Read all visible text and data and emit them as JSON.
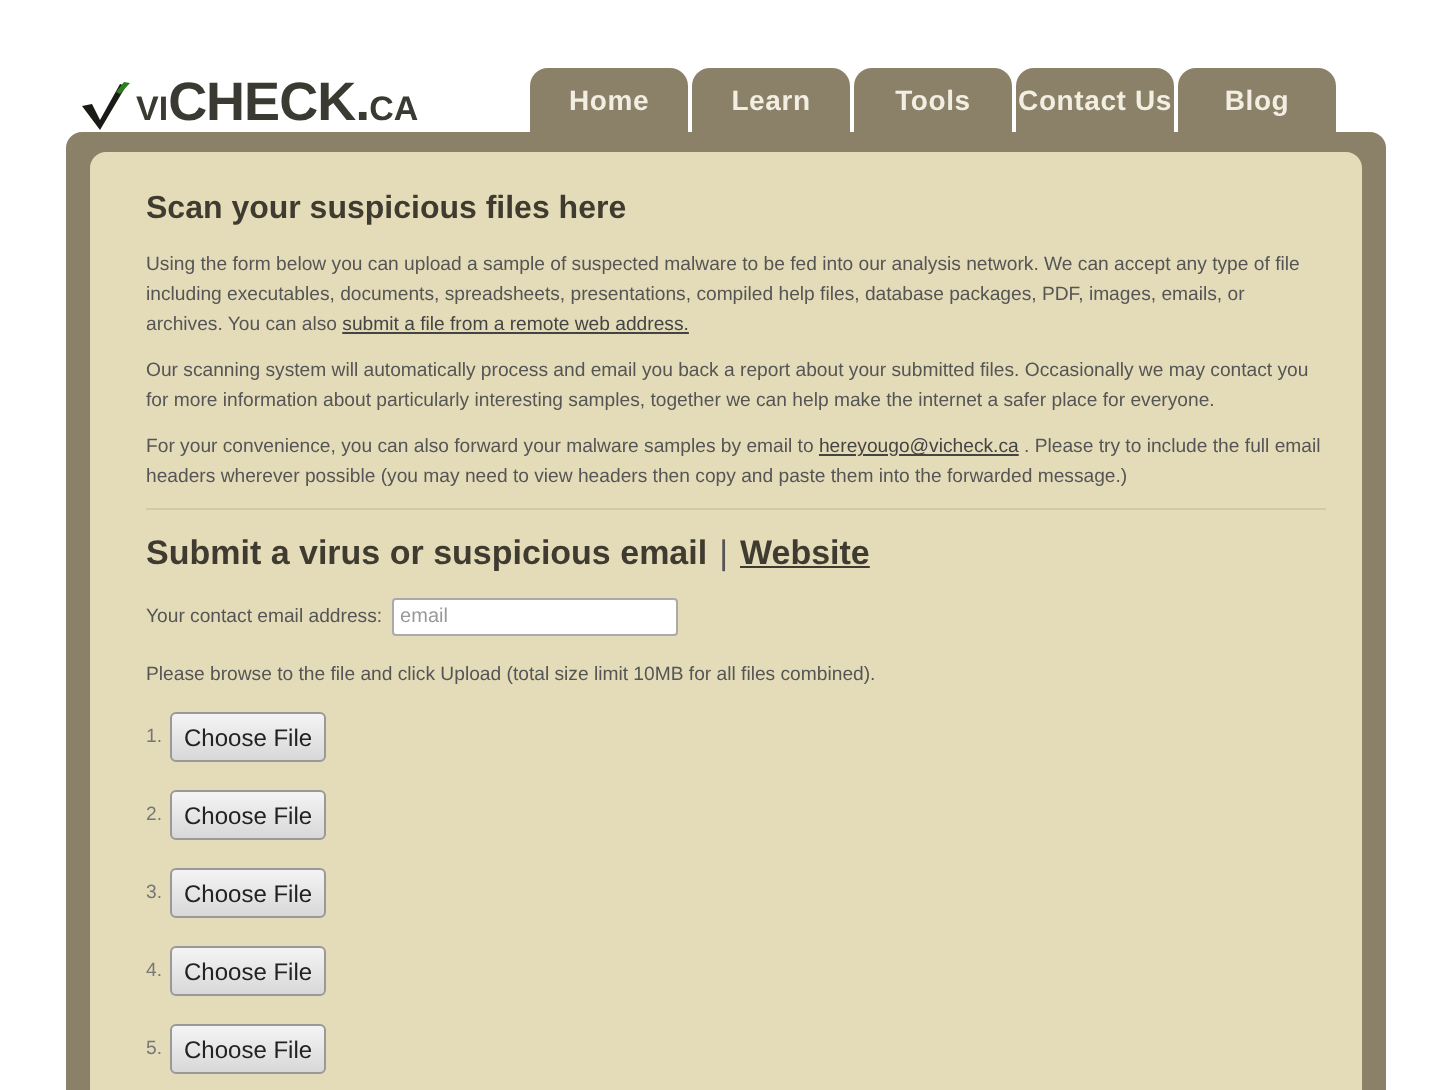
{
  "logo": {
    "prefix": "VI",
    "main": "CHECK.",
    "suffix": "CA"
  },
  "tabs": [
    {
      "label": "Home",
      "selected": false
    },
    {
      "label": "Learn",
      "selected": false
    },
    {
      "label": "Tools",
      "selected": false
    },
    {
      "label": "Contact Us",
      "selected": false
    },
    {
      "label": "Blog",
      "selected": false
    }
  ],
  "intro": {
    "title": "Scan your suspicious files here",
    "paragraphs": [
      {
        "text": "Using the form below you can upload a sample of suspected malware to be fed into our analysis network. We can accept any type of file including executables, documents, spreadsheets, presentations, compiled help files, database packages, PDF, images, emails, or archives. You can also",
        "link": "submit a file from a remote web address."
      },
      {
        "text": "Our scanning system will automatically process and email you back a report about your submitted files. Occasionally we may contact you for more information about particularly interesting samples, together we can help make the internet a safer place for everyone."
      },
      {
        "text": "For your convenience, you can also forward your malware samples by email to",
        "link": "hereyougo@vicheck.ca",
        "after": ". Please try to include the full email headers wherever possible (you may need to view headers then copy and paste them into the forwarded message.)"
      }
    ]
  },
  "form": {
    "title": "Submit a virus or suspicious email",
    "separator": "|",
    "title_link": "Website",
    "email_label": "Your contact email address:",
    "email_placeholder": "email",
    "instructions": "Please browse to the file and click Upload (total size limit 10MB for all files combined).",
    "files": [
      {
        "number": "1.",
        "button": "Choose File"
      },
      {
        "number": "2.",
        "button": "Choose File"
      },
      {
        "number": "3.",
        "button": "Choose File"
      },
      {
        "number": "4.",
        "button": "Choose File"
      },
      {
        "number": "5.",
        "button": "Choose File"
      }
    ]
  }
}
